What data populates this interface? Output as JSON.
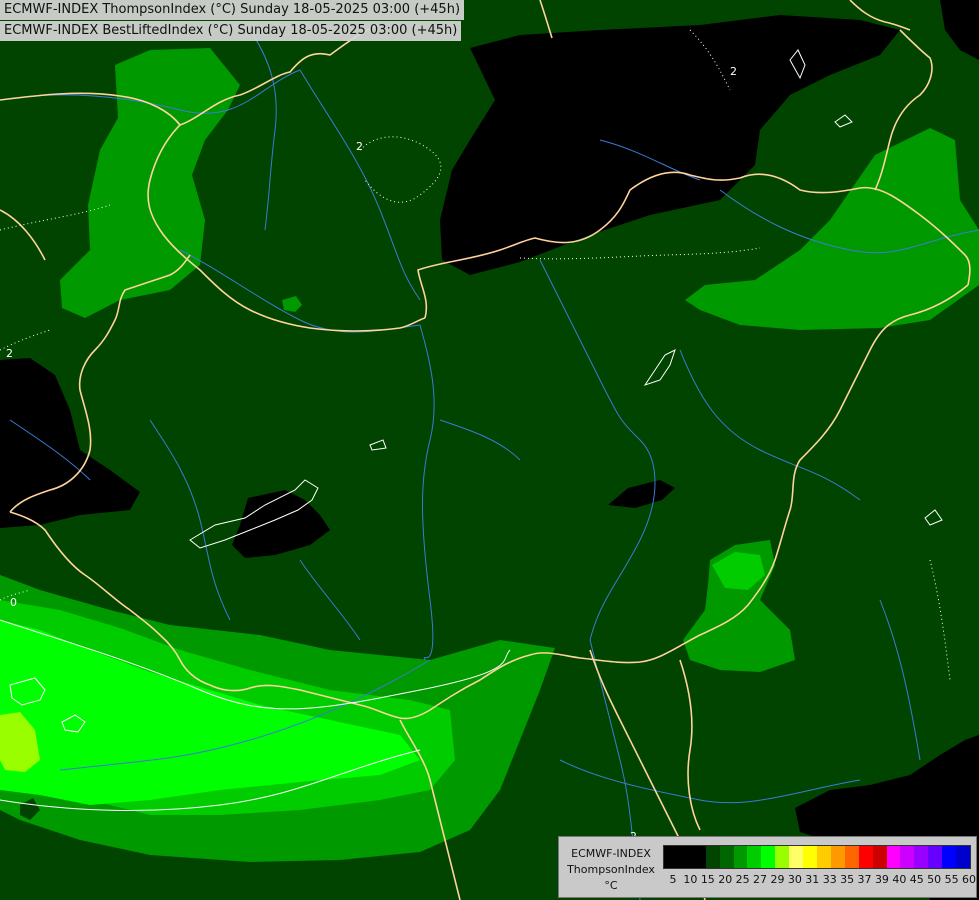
{
  "title_lines": [
    "ECMWF-INDEX ThompsonIndex (°C) Sunday 18-05-2025 03:00 (+45h)",
    "ECMWF-INDEX BestLiftedIndex (°C) Sunday 18-05-2025 03:00 (+45h)"
  ],
  "legend": {
    "source": "ECMWF-INDEX",
    "parameter": "ThompsonIndex",
    "unit": "°C",
    "ticks": [
      "5",
      "10",
      "15",
      "20",
      "25",
      "27",
      "29",
      "30",
      "31",
      "33",
      "35",
      "37",
      "39",
      "40",
      "45",
      "50",
      "55",
      "60"
    ],
    "colors": [
      "#000000",
      "#000000",
      "#000000",
      "#004400",
      "#006600",
      "#009900",
      "#00cc00",
      "#00ff00",
      "#99ff00",
      "#ffff66",
      "#ffff00",
      "#ffcc00",
      "#ff9900",
      "#ff6600",
      "#ff0000",
      "#cc0000",
      "#ff00ff",
      "#cc00ff",
      "#9900ff",
      "#6600ff",
      "#0000ff",
      "#0000cc"
    ]
  },
  "contour_labels": [
    "2",
    "2",
    "2",
    "2",
    "0"
  ],
  "colors": {
    "background": "#004400",
    "black_zone": "#000000",
    "mid_green": "#009900",
    "bright_green": "#00cc00",
    "lime": "#00ff00",
    "yellow_green": "#99ff00",
    "borders": "#ffd39b",
    "rivers": "#3b7bd6",
    "isolines": "#ffffff"
  }
}
